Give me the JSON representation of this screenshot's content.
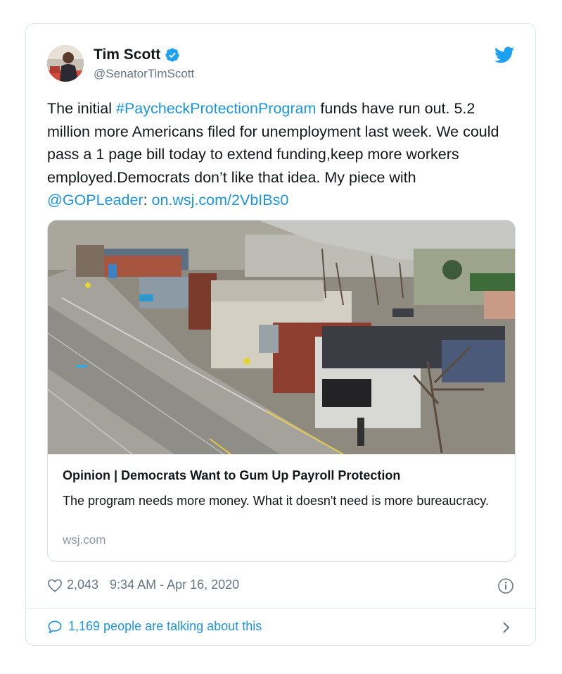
{
  "author": {
    "name": "Tim Scott",
    "handle": "@SenatorTimScott"
  },
  "tweet": {
    "text_1": "The initial ",
    "hashtag": "#PaycheckProtectionProgram",
    "text_2": " funds have run out. 5.2 million more Americans filed for unemployment last week. We could pass a 1 page bill today to extend funding,keep more workers employed.Democrats don’t like that idea. My piece with ",
    "mention": "@GOPLeader",
    "text_3": ": ",
    "url": "on.wsj.com/2VbIBs0"
  },
  "link_card": {
    "title": "Opinion | Democrats Want to Gum Up Payroll Protection",
    "description": "The program needs more money. What it doesn't need is more bureaucracy.",
    "domain": "wsj.com"
  },
  "meta": {
    "likes": "2,043",
    "timestamp": "9:34 AM - Apr 16, 2020"
  },
  "conversation": {
    "label": "1,169 people are talking about this"
  },
  "icons": {
    "verified": "verified-badge-icon",
    "platform": "twitter-bird-icon",
    "like": "heart-icon",
    "info": "info-icon",
    "reply": "speech-bubble-icon",
    "chevron": "chevron-right-icon"
  },
  "colors": {
    "link": "#1b95e0",
    "text": "#14171a",
    "muted": "#657786"
  }
}
